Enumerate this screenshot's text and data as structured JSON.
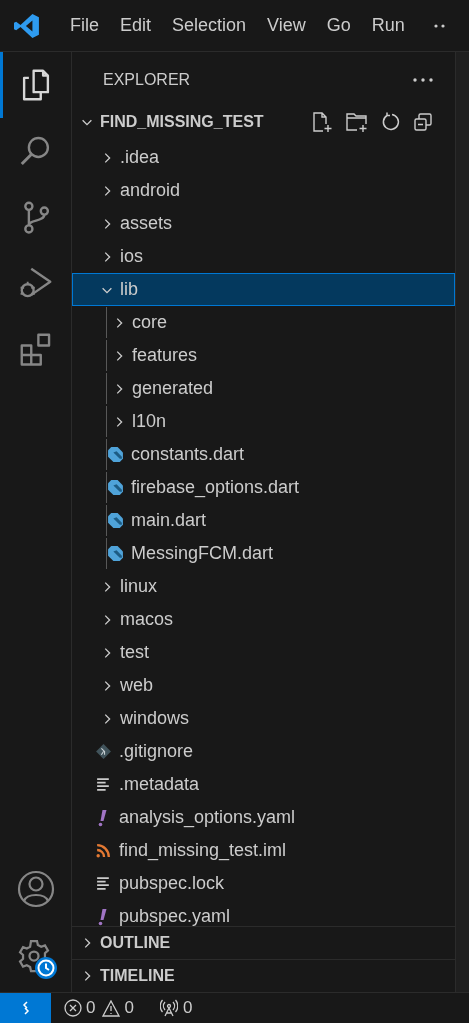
{
  "menu": [
    "File",
    "Edit",
    "Selection",
    "View",
    "Go",
    "Run"
  ],
  "activity_bar": [
    {
      "kind": "explorer",
      "selected": true
    },
    {
      "kind": "search",
      "selected": false
    },
    {
      "kind": "source_control",
      "selected": false
    },
    {
      "kind": "run_debug",
      "selected": false
    },
    {
      "kind": "extensions",
      "selected": false
    }
  ],
  "sidebar": {
    "title": "EXPLORER",
    "root": {
      "name": "FIND_MISSING_TEST",
      "expanded": true
    },
    "tree": [
      {
        "name": ".idea",
        "kind": "folder",
        "expanded": false,
        "selected": false
      },
      {
        "name": "android",
        "kind": "folder",
        "expanded": false,
        "selected": false
      },
      {
        "name": "assets",
        "kind": "folder",
        "expanded": false,
        "selected": false
      },
      {
        "name": "ios",
        "kind": "folder",
        "expanded": false,
        "selected": false
      },
      {
        "name": "lib",
        "kind": "folder",
        "expanded": true,
        "selected": true,
        "children": [
          {
            "name": "core",
            "kind": "folder",
            "expanded": false,
            "selected": false
          },
          {
            "name": "features",
            "kind": "folder",
            "expanded": false,
            "selected": false
          },
          {
            "name": "generated",
            "kind": "folder",
            "expanded": false,
            "selected": false
          },
          {
            "name": "l10n",
            "kind": "folder",
            "expanded": false,
            "selected": false
          },
          {
            "name": "constants.dart",
            "kind": "dart",
            "selected": false
          },
          {
            "name": "firebase_options.dart",
            "kind": "dart",
            "selected": false
          },
          {
            "name": "main.dart",
            "kind": "dart",
            "selected": false
          },
          {
            "name": "MessingFCM.dart",
            "kind": "dart",
            "selected": false
          }
        ]
      },
      {
        "name": "linux",
        "kind": "folder",
        "expanded": false,
        "selected": false
      },
      {
        "name": "macos",
        "kind": "folder",
        "expanded": false,
        "selected": false
      },
      {
        "name": "test",
        "kind": "folder",
        "expanded": false,
        "selected": false
      },
      {
        "name": "web",
        "kind": "folder",
        "expanded": false,
        "selected": false
      },
      {
        "name": "windows",
        "kind": "folder",
        "expanded": false,
        "selected": false
      },
      {
        "name": ".gitignore",
        "kind": "git",
        "selected": false
      },
      {
        "name": ".metadata",
        "kind": "text",
        "selected": false
      },
      {
        "name": "analysis_options.yaml",
        "kind": "yaml",
        "selected": false
      },
      {
        "name": "find_missing_test.iml",
        "kind": "feed",
        "selected": false
      },
      {
        "name": "pubspec.lock",
        "kind": "text",
        "selected": false
      },
      {
        "name": "pubspec.yaml",
        "kind": "yaml",
        "selected": false
      }
    ],
    "panels": [
      {
        "title": "OUTLINE",
        "expanded": false
      },
      {
        "title": "TIMELINE",
        "expanded": false
      }
    ]
  },
  "status_bar": {
    "errors": "0",
    "warnings": "0",
    "ports": "0"
  }
}
